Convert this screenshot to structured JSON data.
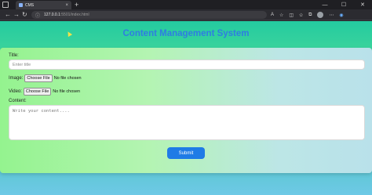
{
  "browser": {
    "tab_title": "CMS",
    "tab_close": "×",
    "new_tab": "+",
    "url_host": "127.0.0.1",
    "url_rest": ":5501/index.html",
    "minimize": "—",
    "maximize": "☐",
    "close": "✕",
    "back": "←",
    "forward": "→",
    "reload": "↻"
  },
  "page": {
    "title": "Content Management System"
  },
  "form": {
    "title_label": "Title:",
    "title_placeholder": "Enter title",
    "image_label": "Image:",
    "video_label": "Video:",
    "choose_file": "Choose File",
    "no_file": "No file chosen",
    "content_label": "Content:",
    "content_placeholder": "Write your content....",
    "submit_label": "Submit"
  },
  "colors": {
    "title": "#2f7de1",
    "submit": "#1f7be6",
    "page_top": "#24cba0",
    "page_bottom": "#6ec9e6"
  }
}
